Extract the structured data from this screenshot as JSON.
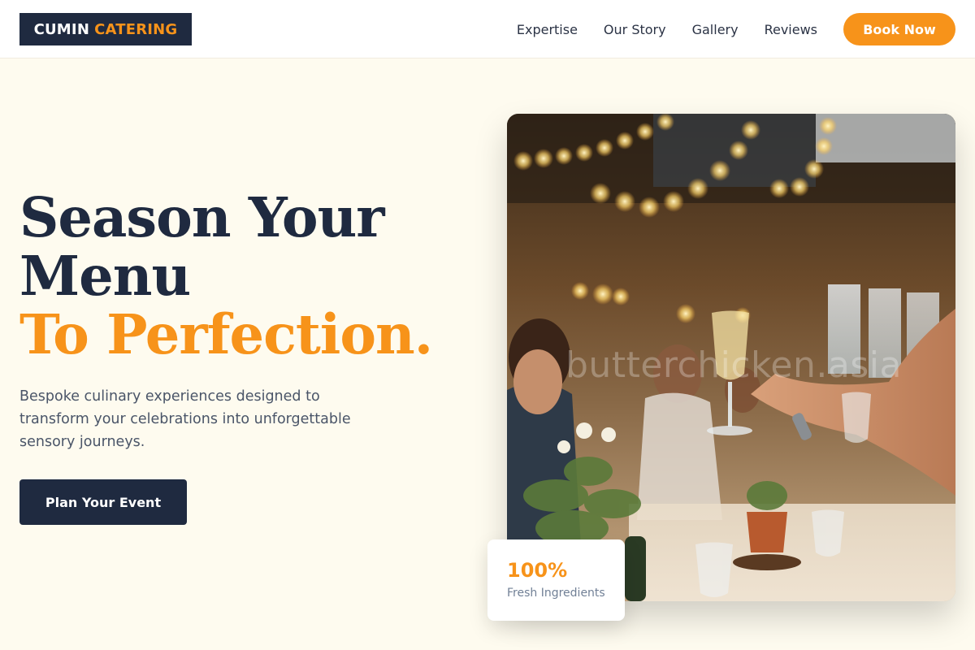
{
  "header": {
    "logo_brand": "CUMIN",
    "logo_accent": "CATERING",
    "nav": [
      {
        "label": "Expertise"
      },
      {
        "label": "Our Story"
      },
      {
        "label": "Gallery"
      },
      {
        "label": "Reviews"
      }
    ],
    "cta_label": "Book Now"
  },
  "hero": {
    "title_line1": "Season Your",
    "title_line2": "Menu",
    "title_line3": "To Perfection.",
    "subtitle": "Bespoke culinary experiences designed to transform your celebrations into unforgettable sensory journeys.",
    "button_label": "Plan Your Event"
  },
  "photo": {
    "watermark": "butterchicken.asia"
  },
  "stat": {
    "value": "100%",
    "label": "Fresh Ingredients"
  },
  "colors": {
    "navy": "#1f2a40",
    "accent": "#f7931a",
    "background": "#fefbef"
  }
}
